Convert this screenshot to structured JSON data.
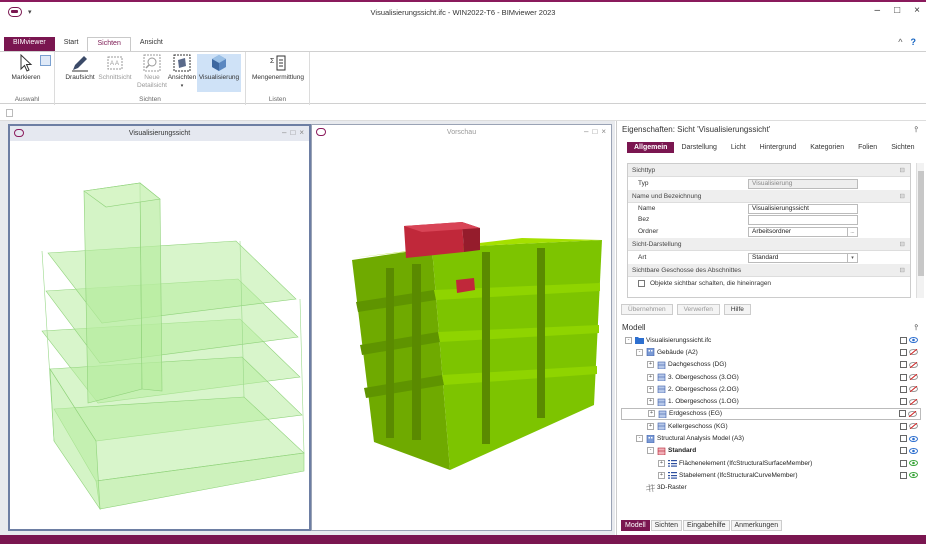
{
  "window": {
    "title": "Visualisierungssicht.ifc - WIN2022-T6 - BIMviewer 2023",
    "quick_access": "▾"
  },
  "ribbon": {
    "tabs": [
      "BIMviewer",
      "Start",
      "Sichten",
      "Ansicht"
    ],
    "active_tab": "Sichten",
    "groups": [
      {
        "label": "Auswahl",
        "buttons": [
          {
            "label": "Markieren",
            "icon": "cursor-icon"
          }
        ]
      },
      {
        "label": "Sichten",
        "buttons": [
          {
            "label": "Draufsicht",
            "icon": "pencil-icon"
          },
          {
            "label": "Schnittsicht",
            "icon": "section-icon",
            "disabled": true
          },
          {
            "label": "Neue Detailsicht",
            "icon": "magnifier-icon",
            "disabled": true
          },
          {
            "label": "Ansichten",
            "icon": "views-icon"
          },
          {
            "label": "Visualisierung",
            "icon": "cube-icon",
            "selected": true
          }
        ]
      },
      {
        "label": "Listen",
        "buttons": [
          {
            "label": "Mengenermittlung",
            "icon": "quantity-list-icon"
          }
        ]
      }
    ]
  },
  "viewports": [
    {
      "title": "Visualisierungssicht",
      "active": true
    },
    {
      "title": "Vorschau",
      "active": false
    }
  ],
  "properties": {
    "title": "Eigenschaften: Sicht 'Visualisierungssicht'",
    "tabs": [
      "Allgemein",
      "Darstellung",
      "Licht",
      "Hintergrund",
      "Kategorien",
      "Folien",
      "Sichten"
    ],
    "active_tab": "Allgemein",
    "sections": [
      {
        "title": "Sichttyp",
        "rows": [
          {
            "label": "Typ",
            "value": "Visualisierung",
            "readonly": true
          }
        ]
      },
      {
        "title": "Name und Bezeichnung",
        "rows": [
          {
            "label": "Name",
            "value": "Visualisierungssicht"
          },
          {
            "label": "Bez",
            "value": ""
          },
          {
            "label": "Ordner",
            "value": "Arbeitsordner",
            "dots": true
          }
        ]
      },
      {
        "title": "Sicht-Darstellung",
        "rows": [
          {
            "label": "Art",
            "value": "Standard",
            "dropdown": true
          }
        ]
      },
      {
        "title": "Sichtbare Geschosse des Abschnittes",
        "rows": [
          {
            "label": "Objekte sichtbar schalten, die hineinragen",
            "checkbox": true
          }
        ]
      }
    ],
    "buttons": [
      {
        "label": "Übernehmen",
        "enabled": false
      },
      {
        "label": "Verwerfen",
        "enabled": false
      },
      {
        "label": "Hilfe",
        "enabled": true
      }
    ]
  },
  "model": {
    "title": "Modell",
    "tree": [
      {
        "label": "Visualisierungssicht.ifc",
        "level": 0,
        "expander": "-",
        "icon": "folder-icon",
        "vis": "eye"
      },
      {
        "label": "Gebäude (A2)",
        "level": 1,
        "expander": "-",
        "icon": "building-icon",
        "vis": "off"
      },
      {
        "label": "Dachgeschoss (DG)",
        "level": 2,
        "expander": "+",
        "icon": "storey-icon",
        "vis": "off"
      },
      {
        "label": "3. Obergeschoss (3.OG)",
        "level": 2,
        "expander": "+",
        "icon": "storey-icon",
        "vis": "off"
      },
      {
        "label": "2. Obergeschoss (2.OG)",
        "level": 2,
        "expander": "+",
        "icon": "storey-icon",
        "vis": "off"
      },
      {
        "label": "1. Obergeschoss (1.OG)",
        "level": 2,
        "expander": "+",
        "icon": "storey-icon",
        "vis": "off"
      },
      {
        "label": "Erdgeschoss (EG)",
        "level": 2,
        "expander": "+",
        "icon": "storey-icon",
        "vis": "off",
        "selected": true
      },
      {
        "label": "Kellergeschoss (KG)",
        "level": 2,
        "expander": "+",
        "icon": "storey-icon",
        "vis": "off"
      },
      {
        "label": "Structural Analysis Model (A3)",
        "level": 1,
        "expander": "-",
        "icon": "building-icon",
        "vis": "eye"
      },
      {
        "label": "Standard",
        "level": 2,
        "expander": "-",
        "icon": "storey-red-icon",
        "vis": "eye",
        "bold": true
      },
      {
        "label": "Flächenelement (IfcStructuralSurfaceMember)",
        "level": 3,
        "expander": "+",
        "icon": "list-icon",
        "vis": "eye-green"
      },
      {
        "label": "Stabelement (IfcStructuralCurveMember)",
        "level": 3,
        "expander": "+",
        "icon": "list-icon",
        "vis": "eye-green"
      },
      {
        "label": "3D-Raster",
        "level": 1,
        "expander": "",
        "icon": "grid-icon",
        "vis": ""
      }
    ]
  },
  "bottom_tabs": [
    "Modell",
    "Sichten",
    "Eingabehilfe",
    "Anmerkungen"
  ],
  "active_bottom_tab": "Modell",
  "colors": {
    "brand": "#7a1650",
    "model_green": "#7dc400",
    "model_red": "#c0283a",
    "ghost_green": "#9fe08a"
  }
}
